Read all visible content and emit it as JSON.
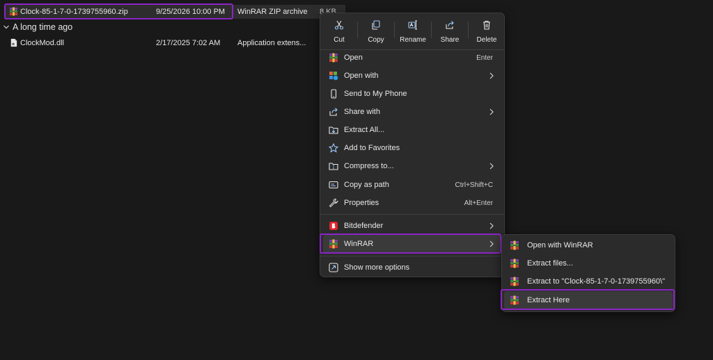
{
  "files": {
    "selected": {
      "name": "Clock-85-1-7-0-1739755960.zip",
      "date": "9/25/2026 10:00 PM",
      "type": "WinRAR ZIP archive",
      "size": "8 KB"
    },
    "group_label": "A long time ago",
    "dll": {
      "name": "ClockMod.dll",
      "date": "2/17/2025 7:02 AM",
      "type": "Application extens..."
    }
  },
  "context_menu": {
    "actions": [
      {
        "label": "Cut",
        "icon": "scissors-icon"
      },
      {
        "label": "Copy",
        "icon": "copy-icon"
      },
      {
        "label": "Rename",
        "icon": "rename-icon"
      },
      {
        "label": "Share",
        "icon": "share-icon"
      },
      {
        "label": "Delete",
        "icon": "trash-icon"
      }
    ],
    "items": [
      {
        "label": "Open",
        "shortcut": "Enter",
        "icon": "winrar-icon"
      },
      {
        "label": "Open with",
        "icon": "open-with-icon",
        "submenu": true
      },
      {
        "label": "Send to My Phone",
        "icon": "phone-icon"
      },
      {
        "label": "Share with",
        "icon": "share-with-icon",
        "submenu": true
      },
      {
        "label": "Extract All...",
        "icon": "extract-all-icon"
      },
      {
        "label": "Add to Favorites",
        "icon": "star-icon"
      },
      {
        "label": "Compress to...",
        "icon": "compress-icon",
        "submenu": true
      },
      {
        "label": "Copy as path",
        "shortcut": "Ctrl+Shift+C",
        "icon": "copy-path-icon"
      },
      {
        "label": "Properties",
        "shortcut": "Alt+Enter",
        "icon": "wrench-icon"
      },
      {
        "label": "Bitdefender",
        "icon": "bitdefender-icon",
        "submenu": true
      },
      {
        "label": "WinRAR",
        "icon": "winrar-icon",
        "submenu": true
      },
      {
        "label": "Show more options",
        "icon": "more-options-icon"
      }
    ]
  },
  "winrar_submenu": {
    "items": [
      {
        "label": "Open with WinRAR"
      },
      {
        "label": "Extract files..."
      },
      {
        "label": "Extract to \"Clock-85-1-7-0-1739755960\\\""
      },
      {
        "label": "Extract Here"
      }
    ]
  },
  "colors": {
    "highlight": "#8b24c7",
    "menu_bg": "#2b2b2b",
    "background": "#191919"
  }
}
